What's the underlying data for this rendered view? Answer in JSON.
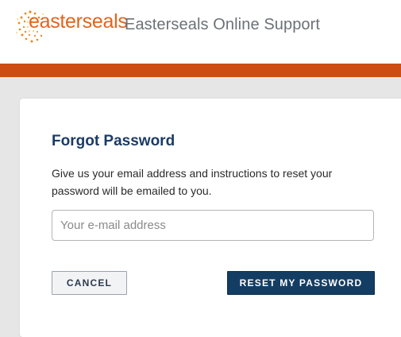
{
  "header": {
    "logo_text": "easterseals",
    "site_title": "Easterseals Online Support"
  },
  "form": {
    "title": "Forgot Password",
    "description": "Give us your email address and instructions to reset your password will be emailed to you.",
    "email_placeholder": "Your e-mail address",
    "email_value": "",
    "cancel_label": "CANCEL",
    "reset_label": "RESET MY PASSWORD"
  },
  "colors": {
    "brand_orange": "#e2641b",
    "orange_bar": "#cc4e12",
    "primary_navy": "#143d63",
    "title_navy": "#1b3b66"
  }
}
